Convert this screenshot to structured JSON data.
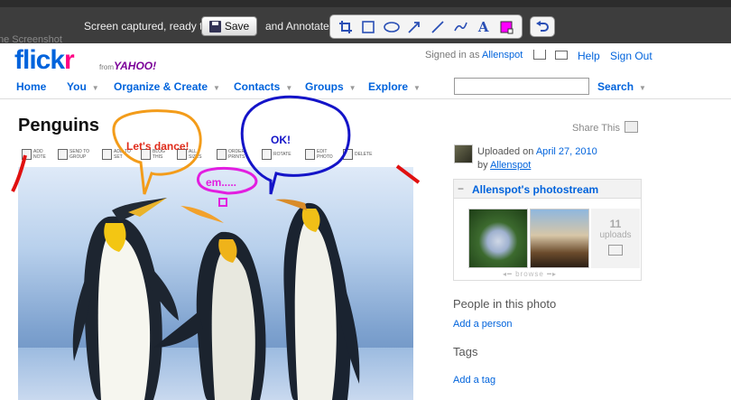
{
  "capture_toolbar": {
    "ghost_text": "ne Screenshot",
    "status_text": "Screen captured, ready to",
    "save_label": "Save",
    "and_annotate_text": "and Annotate",
    "tools": [
      "crop-icon",
      "rectangle-icon",
      "ellipse-icon",
      "arrow-icon",
      "line-icon",
      "freehand-icon",
      "text-icon",
      "color-swatch-icon"
    ],
    "text_tool_glyph": "A",
    "undo": "undo-icon",
    "accent_color": "#ff00ff"
  },
  "header": {
    "logo_blue": "flick",
    "logo_pink": "r",
    "from_text": "from",
    "yahoo_text": "YAHOO!",
    "signed_in_prefix": "Signed in as",
    "username": "Allenspot",
    "help": "Help",
    "sign_out": "Sign Out"
  },
  "nav": {
    "items": [
      "Home",
      "You",
      "Organize & Create",
      "Contacts",
      "Groups",
      "Explore"
    ],
    "search_value": "",
    "search_label": "Search"
  },
  "photo": {
    "title": "Penguins",
    "share_label": "Share This",
    "actions": [
      "ADD NOTE",
      "SEND TO GROUP",
      "ADD TO SET",
      "BLOG THIS",
      "ALL SIZES",
      "ORDER PRINTS",
      "ROTATE",
      "EDIT PHOTO",
      "DELETE"
    ]
  },
  "sidebar": {
    "uploaded_prefix": "Uploaded on",
    "uploaded_date": "April 27, 2010",
    "by_prefix": "by",
    "by_user": "Allenspot",
    "stream_title": "Allenspot's photostream",
    "uploads_count": "11",
    "uploads_label": "uploads",
    "browse_label": "browse",
    "people_heading": "People in this photo",
    "add_person": "Add a person",
    "tags_heading": "Tags",
    "add_tag": "Add a tag"
  },
  "annotations": {
    "orange_bubble": "Let's dance!",
    "blue_bubble": "OK!",
    "magenta_bubble": "em.....",
    "colors": {
      "orange": "#f39c1a",
      "blue": "#1414c8",
      "magenta": "#e21ee0",
      "red": "#e01010"
    }
  }
}
